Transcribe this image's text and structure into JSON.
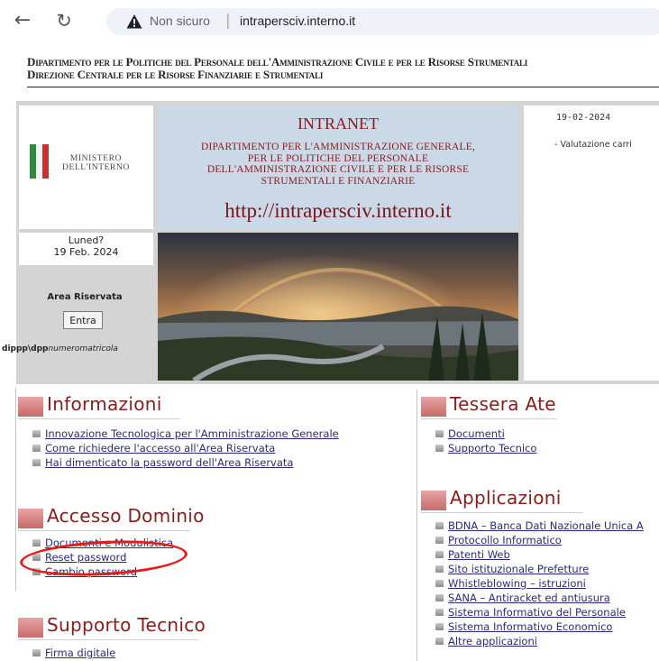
{
  "browser": {
    "insecure_label": "Non sicuro",
    "separator": "|",
    "url": "intrapersciv.interno.it"
  },
  "header": {
    "line1": "Dipartimento per le Politiche del Personale dell'Amministrazione Civile e per le Risorse Strumentali",
    "line2": "Direzione Centrale per le Risorse Finanziarie e Strumentali"
  },
  "logo": {
    "line1": "MINISTERO",
    "line2": "DELL'INTERNO"
  },
  "date": {
    "weekday": "Luned?",
    "day": "19 Feb. 2024"
  },
  "login": {
    "area_label": "Area Riservata",
    "enter_label": "Entra",
    "hint_prefix": "dippp\\dpp",
    "hint_suffix": "numeromatricola"
  },
  "intranet": {
    "title": "INTRANET",
    "dept_line1": "DIPARTIMENTO PER L'AMMINISTRAZIONE GENERALE,",
    "dept_line2": "PER LE POLITICHE DEL PERSONALE",
    "dept_line3": "DELL'AMMINISTRAZIONE CIVILE E PER LE RISORSE",
    "dept_line4": "STRUMENTALI E FINANZIARIE",
    "url": "http://intrapersciv.interno.it"
  },
  "news": {
    "date": "19-02-2024",
    "item": "- Valutazione carri"
  },
  "sections": {
    "informazioni": {
      "title": "Informazioni",
      "links": [
        "Innovazione Tecnologica per l'Amministrazione Generale",
        "Come richiedere l'accesso all'Area Riservata",
        "Hai dimenticato la password dell'Area Riservata"
      ]
    },
    "accesso": {
      "title": "Accesso Dominio",
      "links": [
        "Documenti e Modulistica",
        "Reset password",
        "Cambio password"
      ]
    },
    "supporto": {
      "title": "Supporto Tecnico",
      "links": [
        "Firma digitale"
      ]
    },
    "tessera": {
      "title": "Tessera Ate",
      "links": [
        "Documenti",
        "Supporto Tecnico"
      ]
    },
    "applicazioni": {
      "title": "Applicazioni",
      "links": [
        "BDNA – Banca Dati Nazionale Unica A",
        "Protocollo Informatico",
        "Patenti Web",
        "Sito istituzionale Prefetture",
        "Whistleblowing – istruzioni",
        "SANA – Antiracket ed antiusura",
        "Sistema Informativo del Personale",
        "Sistema Informativo Economico",
        "Altre applicazioni"
      ]
    }
  },
  "colors": {
    "section_title": "#8b1a1a",
    "link": "#2a2a7a",
    "annotation": "#e21b1b"
  },
  "icons": {
    "back": "arrow-left-icon",
    "reload": "reload-icon",
    "warning": "warning-triangle-icon",
    "flag": "italian-flag-icon",
    "bullet": "bullet-icon"
  }
}
